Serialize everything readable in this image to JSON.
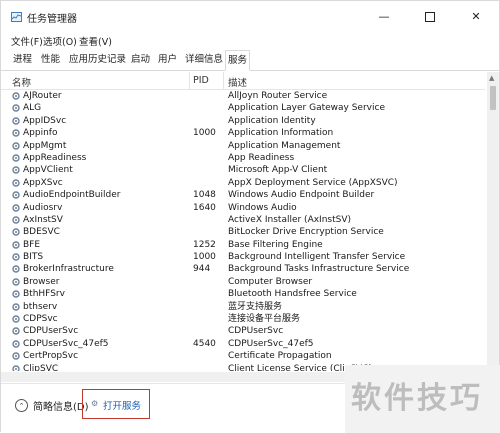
{
  "window": {
    "title": "任务管理器",
    "minimize_icon": "minimize-icon",
    "maximize_icon": "maximize-icon",
    "close_icon": "close-icon"
  },
  "menu": [
    "文件(F)",
    "选项(O)",
    "查看(V)"
  ],
  "tabs": [
    "进程",
    "性能",
    "应用历史记录",
    "启动",
    "用户",
    "详细信息",
    "服务"
  ],
  "active_tab": "服务",
  "columns": {
    "name": "名称",
    "pid": "PID",
    "desc": "描述"
  },
  "rows": [
    {
      "name": "AJRouter",
      "pid": "",
      "desc": "AllJoyn Router Service"
    },
    {
      "name": "ALG",
      "pid": "",
      "desc": "Application Layer Gateway Service"
    },
    {
      "name": "AppIDSvc",
      "pid": "",
      "desc": "Application Identity"
    },
    {
      "name": "Appinfo",
      "pid": "1000",
      "desc": "Application Information"
    },
    {
      "name": "AppMgmt",
      "pid": "",
      "desc": "Application Management"
    },
    {
      "name": "AppReadiness",
      "pid": "",
      "desc": "App Readiness"
    },
    {
      "name": "AppVClient",
      "pid": "",
      "desc": "Microsoft App-V Client"
    },
    {
      "name": "AppXSvc",
      "pid": "",
      "desc": "AppX Deployment Service (AppXSVC)"
    },
    {
      "name": "AudioEndpointBuilder",
      "pid": "1048",
      "desc": "Windows Audio Endpoint Builder"
    },
    {
      "name": "Audiosrv",
      "pid": "1640",
      "desc": "Windows Audio"
    },
    {
      "name": "AxInstSV",
      "pid": "",
      "desc": "ActiveX Installer (AxInstSV)"
    },
    {
      "name": "BDESVC",
      "pid": "",
      "desc": "BitLocker Drive Encryption Service"
    },
    {
      "name": "BFE",
      "pid": "1252",
      "desc": "Base Filtering Engine"
    },
    {
      "name": "BITS",
      "pid": "1000",
      "desc": "Background Intelligent Transfer Service"
    },
    {
      "name": "BrokerInfrastructure",
      "pid": "944",
      "desc": "Background Tasks Infrastructure Service"
    },
    {
      "name": "Browser",
      "pid": "",
      "desc": "Computer Browser"
    },
    {
      "name": "BthHFSrv",
      "pid": "",
      "desc": "Bluetooth Handsfree Service"
    },
    {
      "name": "bthserv",
      "pid": "",
      "desc": "蓝牙支持服务"
    },
    {
      "name": "CDPSvc",
      "pid": "",
      "desc": "连接设备平台服务"
    },
    {
      "name": "CDPUserSvc",
      "pid": "",
      "desc": "CDPUserSvc"
    },
    {
      "name": "CDPUserSvc_47ef5",
      "pid": "4540",
      "desc": "CDPUserSvc_47ef5"
    },
    {
      "name": "CertPropSvc",
      "pid": "",
      "desc": "Certificate Propagation"
    },
    {
      "name": "ClipSVC",
      "pid": "",
      "desc": "Client License Service (ClipSVC)"
    }
  ],
  "footer": {
    "fewer_details": "简略信息(D)",
    "open_services": "打开服务"
  },
  "watermark": "软件技巧",
  "colors": {
    "accent_red": "#c0392b",
    "link_blue": "#1a5fb4",
    "service_icon": "#6b7f99"
  }
}
